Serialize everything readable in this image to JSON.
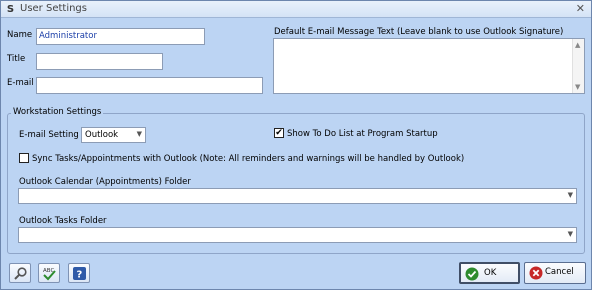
{
  "window": {
    "title": "User Settings",
    "app_icon_glyph": "S",
    "close_glyph": "✕"
  },
  "user": {
    "name_label": "Name",
    "name_value": "Administrator",
    "title_label": "Title",
    "title_value": "",
    "email_label": "E-mail",
    "email_value": ""
  },
  "email_message": {
    "label": "Default E-mail Message Text (Leave blank to use Outlook Signature)",
    "value": ""
  },
  "workstation": {
    "group_title": "Workstation Settings",
    "email_setting_label": "E-mail Setting",
    "email_setting_value": "Outlook",
    "show_todo_label": "Show To Do List at Program Startup",
    "show_todo_checked": true,
    "sync_label": "Sync Tasks/Appointments with Outlook (Note: All reminders and warnings will be handled by Outlook)",
    "sync_checked": false,
    "calendar_folder_label": "Outlook Calendar (Appointments) Folder",
    "calendar_folder_value": "",
    "tasks_folder_label": "Outlook Tasks Folder",
    "tasks_folder_value": ""
  },
  "footer": {
    "tools": [
      "search-icon",
      "spellcheck-icon",
      "help-icon"
    ],
    "ok_label": "OK",
    "cancel_label": "Cancel"
  },
  "colors": {
    "background": "#bcd4f3",
    "name_text": "#1b3ea8",
    "ok_green": "#2e8b2e",
    "cancel_red": "#c62828"
  }
}
